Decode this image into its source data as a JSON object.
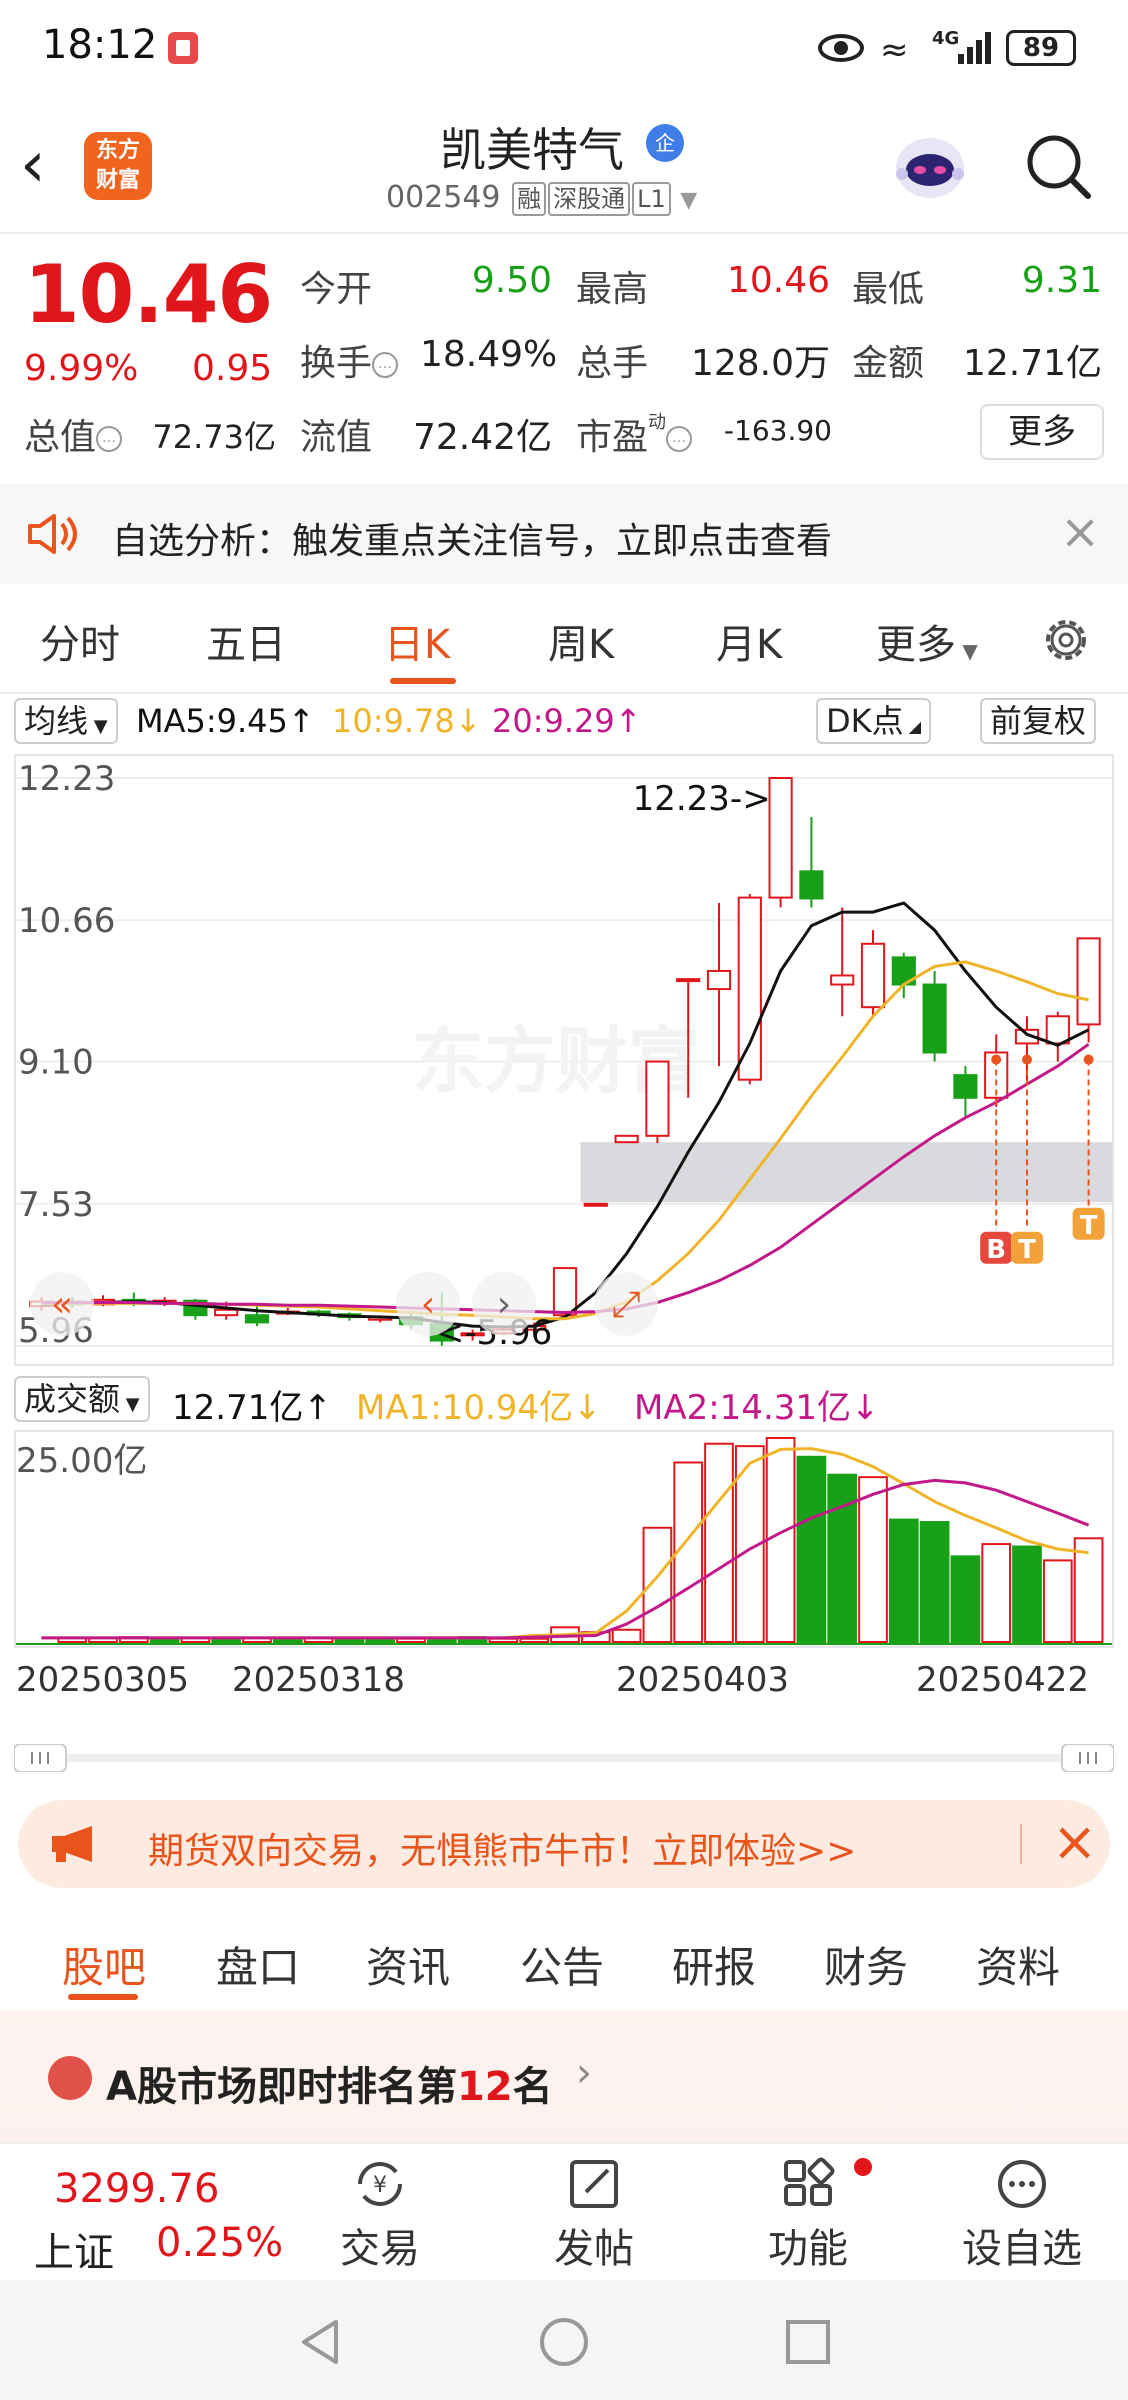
{
  "status": {
    "time": "18:12",
    "network": "4G",
    "battery": "89"
  },
  "header": {
    "logo": "东方\n财富",
    "stock_name": "凯美特气",
    "stock_badge": "企",
    "code": "002549",
    "tags": [
      "融",
      "深股通",
      "L1"
    ]
  },
  "quote": {
    "price": "10.46",
    "pct_change": "9.99%",
    "change": "0.95",
    "open_label": "今开",
    "open": "9.50",
    "high_label": "最高",
    "high": "10.46",
    "low_label": "最低",
    "low": "9.31",
    "turnover_label": "换手",
    "turnover": "18.49%",
    "volume_label": "总手",
    "volume": "128.0万",
    "amount_label": "金额",
    "amount": "12.71亿",
    "mktcap_label": "总值",
    "mktcap": "72.73亿",
    "float_label": "流值",
    "float_cap": "72.42亿",
    "pe_label": "市盈",
    "pe_sup": "动",
    "pe": "-163.90",
    "more_label": "更多"
  },
  "alert": {
    "text": "自选分析：触发重点关注信号，立即点击查看"
  },
  "k_tabs": [
    "分时",
    "五日",
    "日K",
    "周K",
    "月K",
    "更多"
  ],
  "k_tabs_active": "日K",
  "ma_bar": {
    "selector": "均线",
    "ma5": "MA5:9.45↑",
    "ma10": "10:9.78↓",
    "ma20": "20:9.29↑",
    "dk_label": "DK点",
    "adjust_label": "前复权"
  },
  "price_axis": [
    "12.23",
    "10.66",
    "9.10",
    "7.53",
    "5.96"
  ],
  "max_annotation": "12.23->",
  "min_annotation": "<-5.96",
  "watermark": "东方财富",
  "signal_markers": [
    "B",
    "T",
    "T"
  ],
  "volume_bar": {
    "selector": "成交额",
    "value": "12.71亿↑",
    "ma1": "MA1:10.94亿↓",
    "ma2": "MA2:14.31亿↓",
    "axis_max": "25.00亿"
  },
  "date_labels": [
    "20250305",
    "20250318",
    "20250403",
    "20250422"
  ],
  "ad": {
    "text": "期货双向交易，无惧熊市牛市！立即体验>>"
  },
  "bottom_tabs": [
    "股吧",
    "盘口",
    "资讯",
    "公告",
    "研报",
    "财务",
    "资料"
  ],
  "rank": {
    "prefix": "A股市场即时排名第",
    "rank": "12",
    "suffix": "名"
  },
  "bottom_nav": {
    "index_value": "3299.76",
    "index_name": "上证",
    "index_pct": "0.25%",
    "items": [
      "交易",
      "发帖",
      "功能",
      "设自选"
    ]
  },
  "colors": {
    "up": "#e0161b",
    "down": "#18a018",
    "accent": "#e8541c",
    "ma5": "#111111",
    "ma10": "#f0b429",
    "ma20": "#c2188a"
  },
  "chart_data": [
    {
      "type": "candlestick",
      "title": "日K",
      "ylim": [
        5.96,
        12.23
      ],
      "y_ticks": [
        12.23,
        10.66,
        9.1,
        7.53,
        5.96
      ],
      "x_tick_labels": [
        "20250305",
        "20250318",
        "20250403",
        "20250422"
      ],
      "candles": [
        {
          "o": 6.4,
          "c": 6.45,
          "h": 6.5,
          "l": 6.35
        },
        {
          "o": 6.45,
          "c": 6.42,
          "h": 6.5,
          "l": 6.38
        },
        {
          "o": 6.42,
          "c": 6.47,
          "h": 6.52,
          "l": 6.4
        },
        {
          "o": 6.47,
          "c": 6.44,
          "h": 6.55,
          "l": 6.4
        },
        {
          "o": 6.44,
          "c": 6.46,
          "h": 6.5,
          "l": 6.4
        },
        {
          "o": 6.46,
          "c": 6.3,
          "h": 6.48,
          "l": 6.25
        },
        {
          "o": 6.3,
          "c": 6.36,
          "h": 6.45,
          "l": 6.25
        },
        {
          "o": 6.3,
          "c": 6.22,
          "h": 6.4,
          "l": 6.18
        },
        {
          "o": 6.32,
          "c": 6.34,
          "h": 6.38,
          "l": 6.3
        },
        {
          "o": 6.34,
          "c": 6.31,
          "h": 6.36,
          "l": 6.28
        },
        {
          "o": 6.31,
          "c": 6.28,
          "h": 6.33,
          "l": 6.24
        },
        {
          "o": 6.25,
          "c": 6.28,
          "h": 6.3,
          "l": 6.22
        },
        {
          "o": 6.28,
          "c": 6.2,
          "h": 6.32,
          "l": 6.15
        },
        {
          "o": 6.2,
          "c": 6.02,
          "h": 6.55,
          "l": 5.96
        },
        {
          "o": 6.08,
          "c": 6.1,
          "h": 6.14,
          "l": 6.02
        },
        {
          "o": 6.1,
          "c": 6.14,
          "h": 6.18,
          "l": 6.08
        },
        {
          "o": 6.14,
          "c": 6.18,
          "h": 6.22,
          "l": 6.12
        },
        {
          "o": 6.3,
          "c": 6.82,
          "h": 6.82,
          "l": 6.3
        },
        {
          "o": 7.53,
          "c": 7.53,
          "h": 7.53,
          "l": 7.53
        },
        {
          "o": 8.21,
          "c": 8.28,
          "h": 8.28,
          "l": 8.21
        },
        {
          "o": 8.28,
          "c": 9.1,
          "h": 9.1,
          "l": 8.2
        },
        {
          "o": 10.01,
          "c": 10.01,
          "h": 10.01,
          "l": 8.7
        },
        {
          "o": 9.9,
          "c": 10.1,
          "h": 10.85,
          "l": 9.05
        },
        {
          "o": 8.9,
          "c": 10.91,
          "h": 10.95,
          "l": 8.85
        },
        {
          "o": 10.91,
          "c": 12.23,
          "h": 12.23,
          "l": 10.8
        },
        {
          "o": 11.2,
          "c": 10.9,
          "h": 11.8,
          "l": 10.8
        },
        {
          "o": 9.95,
          "c": 10.05,
          "h": 10.8,
          "l": 9.6
        },
        {
          "o": 9.7,
          "c": 10.4,
          "h": 10.55,
          "l": 9.6
        },
        {
          "o": 10.25,
          "c": 9.95,
          "h": 10.3,
          "l": 9.8
        },
        {
          "o": 9.95,
          "c": 9.2,
          "h": 10.1,
          "l": 9.1
        },
        {
          "o": 8.95,
          "c": 8.7,
          "h": 9.05,
          "l": 8.5
        },
        {
          "o": 8.7,
          "c": 9.2,
          "h": 9.4,
          "l": 8.6
        },
        {
          "o": 9.3,
          "c": 9.45,
          "h": 9.6,
          "l": 8.85
        },
        {
          "o": 9.3,
          "c": 9.6,
          "h": 9.65,
          "l": 9.1
        },
        {
          "o": 9.51,
          "c": 10.46,
          "h": 10.46,
          "l": 9.31
        }
      ],
      "ma_series": [
        {
          "name": "MA5",
          "values": [
            6.42,
            6.43,
            6.44,
            6.45,
            6.44,
            6.41,
            6.38,
            6.35,
            6.33,
            6.31,
            6.29,
            6.28,
            6.27,
            6.22,
            6.18,
            6.17,
            6.18,
            6.28,
            6.55,
            6.98,
            7.5,
            8.1,
            8.65,
            9.3,
            10.1,
            10.6,
            10.75,
            10.75,
            10.85,
            10.55,
            10.1,
            9.7,
            9.4,
            9.28,
            9.45
          ]
        },
        {
          "name": "MA10",
          "values": [
            6.43,
            6.43,
            6.43,
            6.43,
            6.43,
            6.43,
            6.42,
            6.41,
            6.4,
            6.39,
            6.37,
            6.35,
            6.33,
            6.31,
            6.3,
            6.28,
            6.26,
            6.26,
            6.32,
            6.45,
            6.68,
            6.98,
            7.35,
            7.8,
            8.25,
            8.72,
            9.15,
            9.6,
            9.95,
            10.15,
            10.2,
            10.1,
            9.98,
            9.85,
            9.78
          ]
        },
        {
          "name": "MA20",
          "values": [
            6.44,
            6.44,
            6.44,
            6.44,
            6.43,
            6.43,
            6.42,
            6.42,
            6.41,
            6.41,
            6.4,
            6.39,
            6.38,
            6.37,
            6.36,
            6.35,
            6.34,
            6.33,
            6.34,
            6.37,
            6.44,
            6.55,
            6.68,
            6.85,
            7.05,
            7.3,
            7.55,
            7.8,
            8.05,
            8.28,
            8.48,
            8.65,
            8.85,
            9.05,
            9.29
          ]
        }
      ],
      "shaded_band": [
        7.55,
        8.21
      ]
    },
    {
      "type": "bar",
      "title": "成交额",
      "ylabel": "亿",
      "ylim": [
        0,
        25.0
      ],
      "bars": [
        {
          "v": 0.5,
          "up": true
        },
        {
          "v": 0.5,
          "up": true
        },
        {
          "v": 0.6,
          "up": true
        },
        {
          "v": 0.5,
          "up": false
        },
        {
          "v": 0.5,
          "up": true
        },
        {
          "v": 0.5,
          "up": false
        },
        {
          "v": 0.5,
          "up": true
        },
        {
          "v": 0.4,
          "up": false
        },
        {
          "v": 0.5,
          "up": true
        },
        {
          "v": 0.4,
          "up": false
        },
        {
          "v": 0.4,
          "up": false
        },
        {
          "v": 0.4,
          "up": true
        },
        {
          "v": 0.5,
          "up": false
        },
        {
          "v": 0.6,
          "up": false
        },
        {
          "v": 0.4,
          "up": true
        },
        {
          "v": 0.4,
          "up": true
        },
        {
          "v": 1.8,
          "up": true
        },
        {
          "v": 1.2,
          "up": true
        },
        {
          "v": 1.5,
          "up": true
        },
        {
          "v": 14.0,
          "up": true
        },
        {
          "v": 22.0,
          "up": true
        },
        {
          "v": 24.3,
          "up": true
        },
        {
          "v": 24.0,
          "up": true
        },
        {
          "v": 25.0,
          "up": true
        },
        {
          "v": 22.7,
          "up": false
        },
        {
          "v": 20.5,
          "up": false
        },
        {
          "v": 20.2,
          "up": true
        },
        {
          "v": 15.0,
          "up": false
        },
        {
          "v": 14.7,
          "up": false
        },
        {
          "v": 10.5,
          "up": false
        },
        {
          "v": 12.0,
          "up": true
        },
        {
          "v": 11.7,
          "up": false
        },
        {
          "v": 10.0,
          "up": true
        },
        {
          "v": 12.71,
          "up": true
        }
      ],
      "ma_series": [
        {
          "name": "MA1",
          "values": [
            0.5,
            0.5,
            0.5,
            0.5,
            0.5,
            0.5,
            0.5,
            0.5,
            0.5,
            0.5,
            0.5,
            0.5,
            0.5,
            0.5,
            0.5,
            0.5,
            0.8,
            0.9,
            1.1,
            3.8,
            8.0,
            12.7,
            17.3,
            21.9,
            23.6,
            23.7,
            23.0,
            21.5,
            19.4,
            17.2,
            15.5,
            14.0,
            12.4,
            11.4,
            10.94
          ]
        },
        {
          "name": "MA2",
          "values": [
            0.5,
            0.5,
            0.5,
            0.5,
            0.5,
            0.5,
            0.5,
            0.5,
            0.5,
            0.5,
            0.5,
            0.5,
            0.5,
            0.5,
            0.5,
            0.5,
            0.6,
            0.7,
            0.8,
            2.2,
            4.3,
            6.6,
            9.0,
            11.4,
            13.4,
            15.2,
            16.6,
            18.1,
            19.3,
            19.8,
            19.5,
            18.6,
            17.2,
            15.8,
            14.31
          ]
        }
      ]
    }
  ]
}
